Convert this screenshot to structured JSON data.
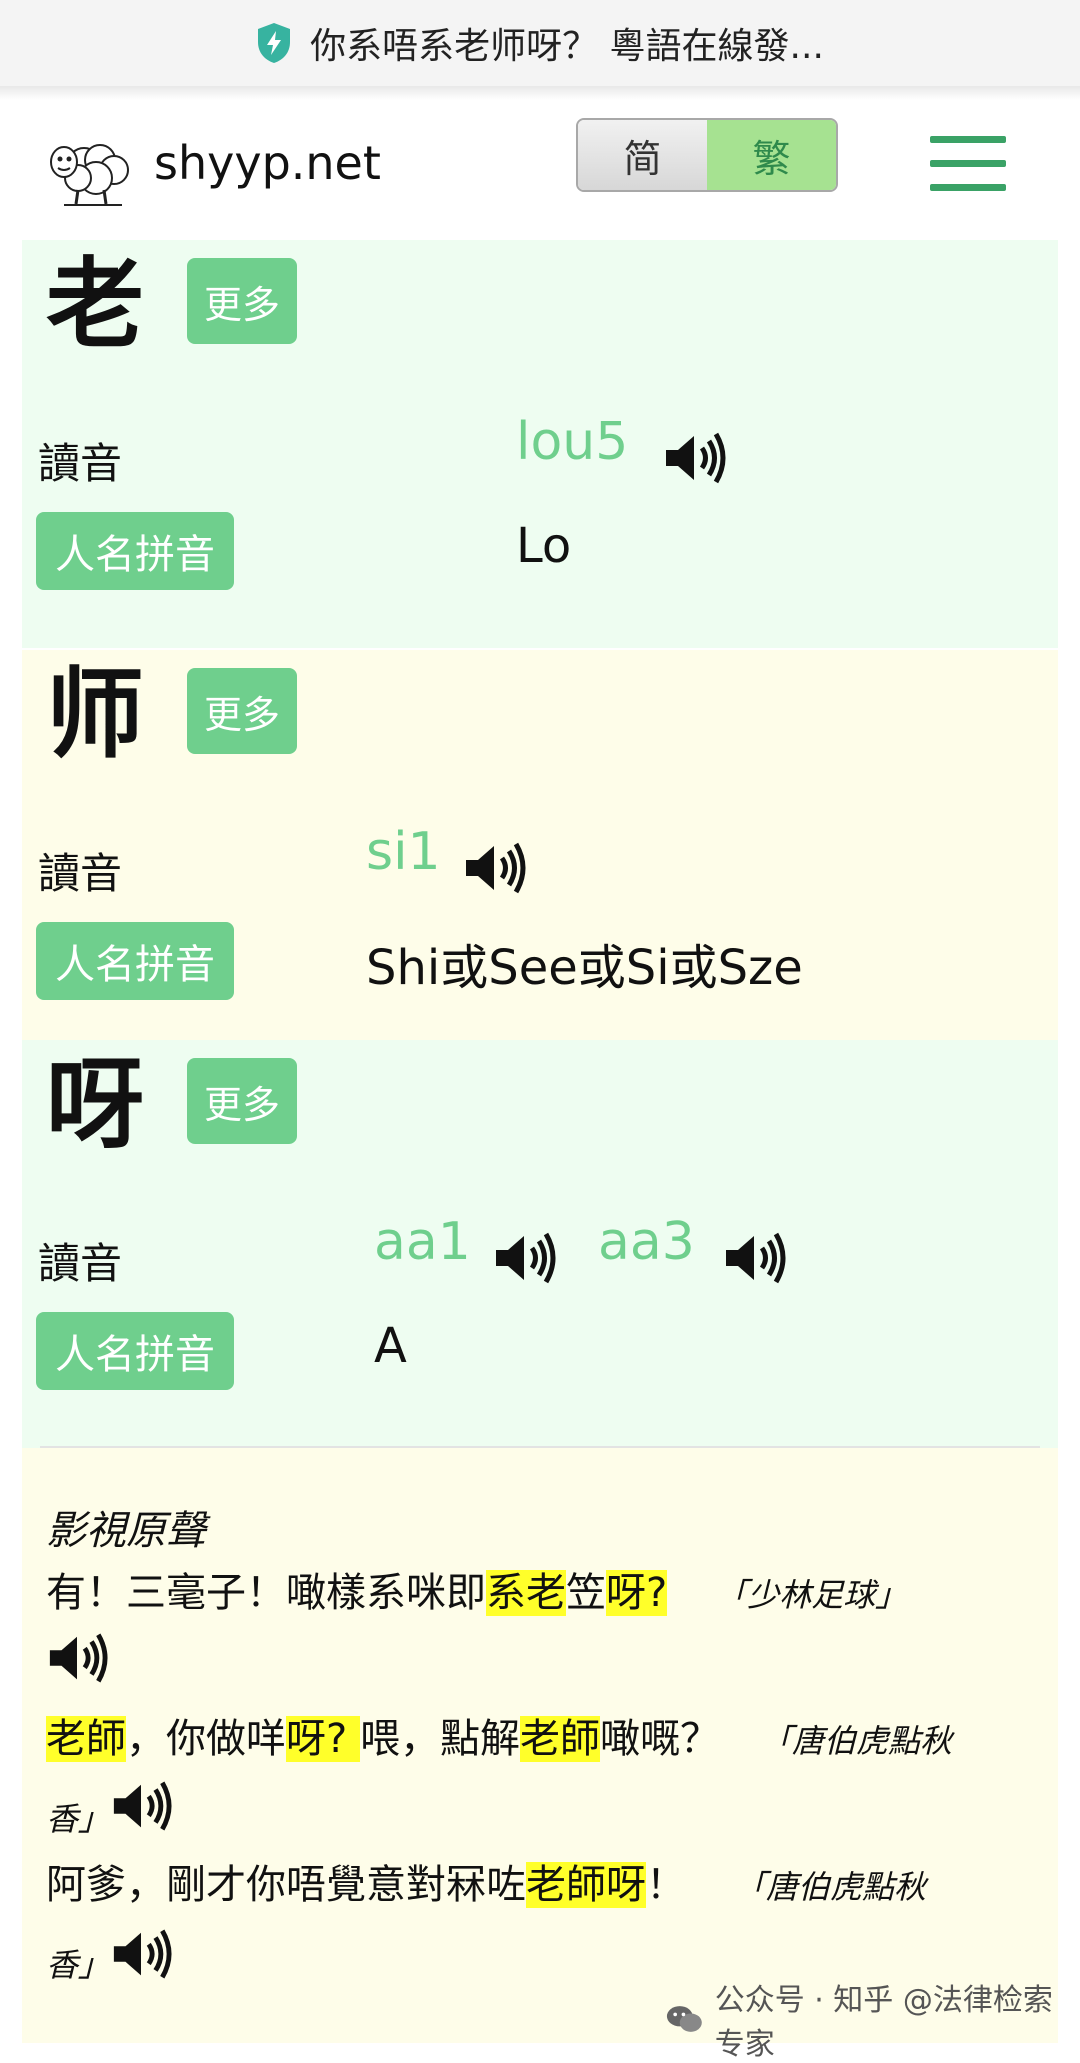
{
  "top_banner": {
    "title": "你系唔系老师呀？ 粵語在線發..."
  },
  "header": {
    "site_name": "shyyp.net",
    "toggle": {
      "simplified": "简",
      "traditional": "繁"
    }
  },
  "characters": [
    {
      "char": "老",
      "more_label": "更多",
      "reading_label": "讀音",
      "readings": [
        "lou5"
      ],
      "name_label": "人名拼音",
      "name_romanization": "Lo"
    },
    {
      "char": "师",
      "more_label": "更多",
      "reading_label": "讀音",
      "readings": [
        "si1"
      ],
      "name_label": "人名拼音",
      "name_romanization": "Shi或See或Si或Sze"
    },
    {
      "char": "呀",
      "more_label": "更多",
      "reading_label": "讀音",
      "readings": [
        "aa1",
        "aa3"
      ],
      "name_label": "人名拼音",
      "name_romanization": "A"
    }
  ],
  "quotes": {
    "title": "影視原聲",
    "items": [
      {
        "parts": [
          "有！三毫子！噉樣系咪即",
          "系老",
          "笠",
          "呀?"
        ],
        "source": "「少林足球」"
      },
      {
        "parts": [
          "老師",
          "，你做咩",
          "呀? ",
          "喂，點解",
          "老師",
          "噉嘅？"
        ],
        "source_line1": "「唐伯虎點秋",
        "source_line2": "香」"
      },
      {
        "parts": [
          "阿爹，剛才你唔覺意對冧咗",
          "老師呀",
          "！"
        ],
        "source_line1": "「唐伯虎點秋",
        "source_line2": "香」"
      }
    ]
  },
  "watermark": {
    "text": "公众号 · 知乎 @法律检索专家"
  },
  "colors": {
    "accent_green": "#6fcf8d",
    "mint_bg": "#eefdf1",
    "cream_bg": "#fefde9",
    "highlight": "#ffff2a",
    "menu_green": "#3aa266"
  }
}
